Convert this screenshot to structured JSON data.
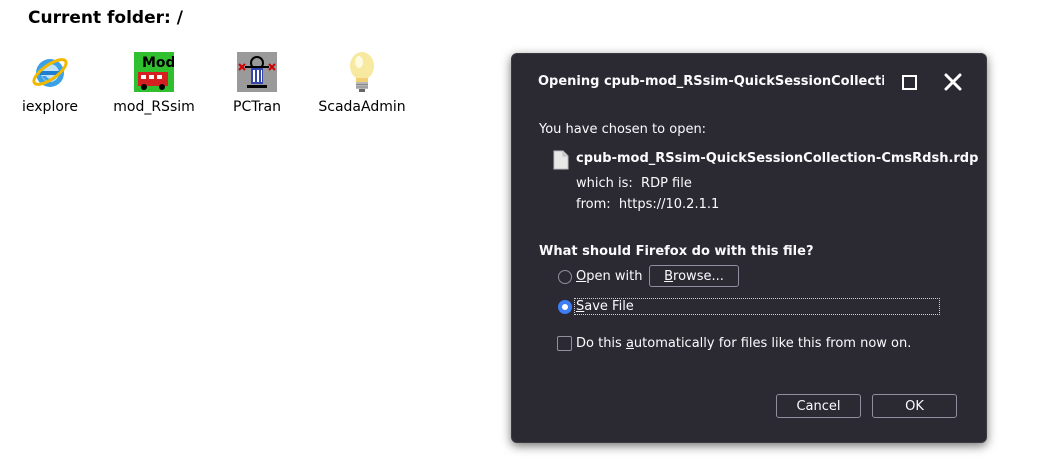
{
  "folder": {
    "title": "Current folder: /"
  },
  "desktop_icons": [
    {
      "label": "iexplore",
      "icon": "internet-explorer-icon"
    },
    {
      "label": "mod_RSsim",
      "icon": "mod-rssim-icon",
      "icon_text": "Mod"
    },
    {
      "label": "PCTran",
      "icon": "pctran-icon"
    },
    {
      "label": "ScadaAdmin",
      "icon": "lightbulb-icon"
    }
  ],
  "dialog": {
    "title": "Opening cpub-mod_RSsim-QuickSessionCollection-CmsRdsh.rdp",
    "chosen_text": "You have chosen to open:",
    "file_name": "cpub-mod_RSsim-QuickSessionCollection-CmsRdsh.rdp",
    "which_is_label": "which is:",
    "which_is_value": "RDP file",
    "from_label": "from:",
    "from_value": "https://10.2.1.1",
    "question": "What should Firefox do with this file?",
    "open_with": {
      "prefix": "O",
      "rest": "pen with",
      "checked": false
    },
    "browse_button": {
      "prefix": "B",
      "rest": "rowse..."
    },
    "save_file": {
      "prefix": "S",
      "rest": "ave File",
      "checked": true
    },
    "auto_checkbox": {
      "before": "Do this ",
      "underlined": "a",
      "after": "utomatically for files like this from now on.",
      "checked": false
    },
    "cancel_label": "Cancel",
    "ok_label": "OK"
  },
  "colors": {
    "dialog_bg": "#2b2a33",
    "text": "#fbfbfe",
    "accent": "#3d7df5"
  }
}
